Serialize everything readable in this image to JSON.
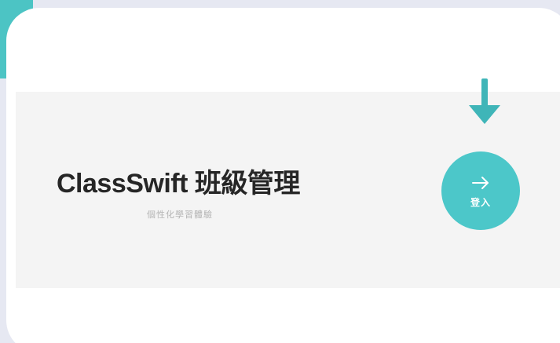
{
  "app": {
    "title": "ClassSwift 班級管理",
    "subtitle": "個性化學習體驗"
  },
  "login_button": {
    "label": "登入",
    "icon": "arrow-right-icon"
  },
  "pointer": {
    "icon": "arrow-down-icon"
  },
  "colors": {
    "accent": "#4cc7c9",
    "page_background": "#e6e8f2",
    "card_background": "#ffffff",
    "banner_background": "#f4f4f4",
    "title_text": "#262626"
  }
}
